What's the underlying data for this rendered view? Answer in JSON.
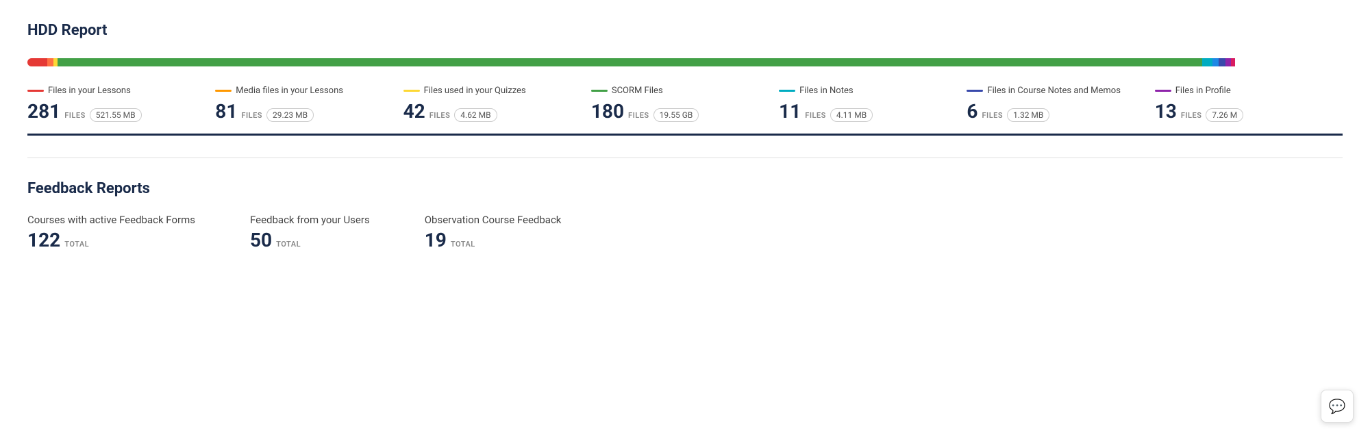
{
  "hdd_section": {
    "title": "HDD Report",
    "progress_bar": [
      {
        "label": "files-in-lessons-segment",
        "color": "#e53935",
        "width": 1.5
      },
      {
        "label": "orange-segment",
        "color": "#ff7043",
        "width": 0.5
      },
      {
        "label": "yellow-segment",
        "color": "#fdd835",
        "width": 0.3
      },
      {
        "label": "green-main-segment",
        "color": "#43a047",
        "width": 87.0
      },
      {
        "label": "teal-segment",
        "color": "#00acc1",
        "width": 0.8
      },
      {
        "label": "blue-segment",
        "color": "#1e88e5",
        "width": 0.5
      },
      {
        "label": "indigo-segment",
        "color": "#3949ab",
        "width": 0.5
      },
      {
        "label": "purple-segment",
        "color": "#8e24aa",
        "width": 0.4
      },
      {
        "label": "pink-segment",
        "color": "#d81b60",
        "width": 0.3
      }
    ],
    "stats": [
      {
        "id": "files-in-lessons",
        "color": "#e53935",
        "label": "Files in your Lessons",
        "count": "281",
        "files_label": "FILES",
        "size": "521.55 MB"
      },
      {
        "id": "media-files-lessons",
        "color": "#ff9800",
        "label": "Media files in your Lessons",
        "count": "81",
        "files_label": "FILES",
        "size": "29.23 MB"
      },
      {
        "id": "files-quizzes",
        "color": "#fdd835",
        "label": "Files used in your Quizzes",
        "count": "42",
        "files_label": "FILES",
        "size": "4.62 MB"
      },
      {
        "id": "scorm-files",
        "color": "#43a047",
        "label": "SCORM Files",
        "count": "180",
        "files_label": "FILES",
        "size": "19.55 GB"
      },
      {
        "id": "files-notes",
        "color": "#00acc1",
        "label": "Files in Notes",
        "count": "11",
        "files_label": "FILES",
        "size": "4.11 MB"
      },
      {
        "id": "files-course-notes-memos",
        "color": "#3949ab",
        "label": "Files in Course Notes and Memos",
        "count": "6",
        "files_label": "FILES",
        "size": "1.32 MB"
      },
      {
        "id": "files-profile",
        "color": "#8e24aa",
        "label": "Files in Profile",
        "count": "13",
        "files_label": "FILES",
        "size": "7.26 M"
      }
    ]
  },
  "feedback_section": {
    "title": "Feedback Reports",
    "items": [
      {
        "id": "active-feedback-forms",
        "label": "Courses with active Feedback Forms",
        "count": "122",
        "total_label": "TOTAL"
      },
      {
        "id": "feedback-from-users",
        "label": "Feedback from your Users",
        "count": "50",
        "total_label": "TOTAL"
      },
      {
        "id": "observation-course-feedback",
        "label": "Observation Course Feedback",
        "count": "19",
        "total_label": "TOTAL"
      }
    ]
  },
  "chat_button": {
    "icon": "💬"
  }
}
